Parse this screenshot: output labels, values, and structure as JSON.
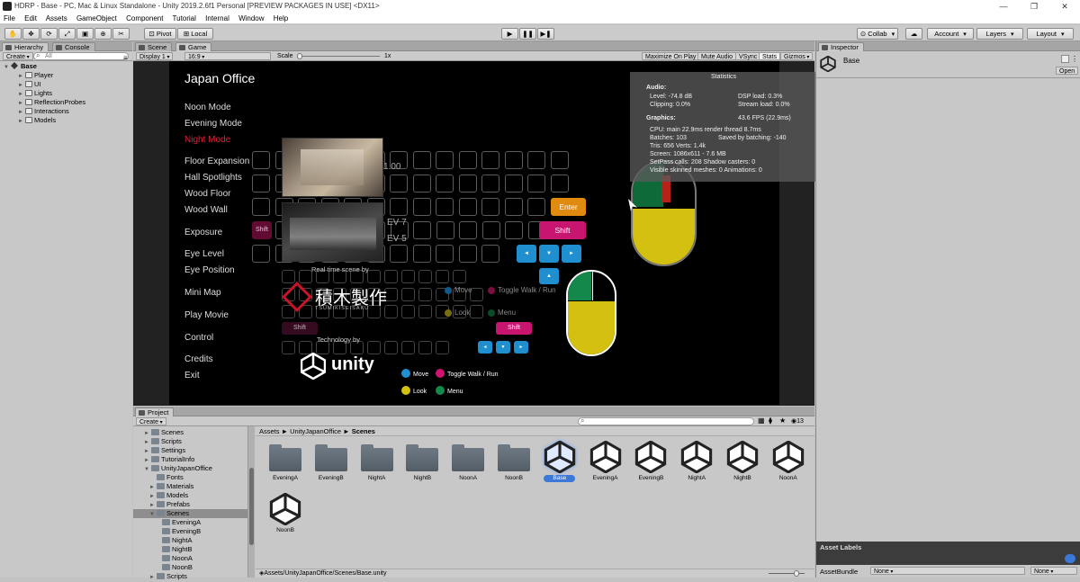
{
  "window": {
    "title": "HDRP - Base - PC, Mac & Linux Standalone - Unity 2019.2.6f1 Personal [PREVIEW PACKAGES IN USE] <DX11>",
    "controls": [
      "—",
      "❐",
      "✕"
    ]
  },
  "menu": [
    "File",
    "Edit",
    "Assets",
    "GameObject",
    "Component",
    "Tutorial",
    "Internal",
    "Window",
    "Help"
  ],
  "toolbar": {
    "pivot_label": "Pivot",
    "local_label": "Local",
    "collab_label": "Collab",
    "account_label": "Account",
    "layers_label": "Layers",
    "layout_label": "Layout",
    "transform_tools": [
      "hand-tool-icon",
      "move-tool-icon",
      "rotate-tool-icon",
      "scale-tool-icon",
      "rect-tool-icon",
      "transform-tool-icon",
      "custom-tool-icon"
    ],
    "play_glyph": "▶",
    "pause_glyph": "❚❚",
    "step_glyph": "▶❚"
  },
  "hierarchy": {
    "tab": "Hierarchy",
    "create": "Create",
    "search_placeholder": "All",
    "root": "Base",
    "items": [
      "Player",
      "UI",
      "Lights",
      "ReflectionProbes",
      "Interactions",
      "Models"
    ]
  },
  "console_tab": "Console",
  "game": {
    "scene_tab": "Scene",
    "game_tab": "Game",
    "display": "Display 1",
    "aspect": "16:9",
    "scale_label": "Scale",
    "scale_value": "1x",
    "maximize": "Maximize On Play",
    "mute": "Mute Audio",
    "vsync": "VSync",
    "stats": "Stats",
    "gizmos": "Gizmos"
  },
  "game_ui": {
    "title": "Japan Office",
    "menu_items": [
      {
        "label": "Noon Mode",
        "active": false
      },
      {
        "label": "Evening Mode",
        "active": false
      },
      {
        "label": "Night Mode",
        "active": true
      },
      {
        "label": "Floor Expansion",
        "active": false
      },
      {
        "label": "Hall Spotlights",
        "active": false
      },
      {
        "label": "Wood Floor",
        "active": false
      },
      {
        "label": "Wood Wall",
        "active": false
      },
      {
        "label": "Exposure",
        "active": false
      },
      {
        "label": "Eye Level",
        "active": false
      },
      {
        "label": "Eye Position",
        "active": false
      },
      {
        "label": "Mini Map",
        "active": false
      },
      {
        "label": "Play Movie",
        "active": false
      },
      {
        "label": "Control",
        "active": false
      },
      {
        "label": "Credits",
        "active": false
      },
      {
        "label": "Exit",
        "active": false
      }
    ],
    "value_100": "1.00",
    "ev_7": "EV 7",
    "ev_5": "EV 5",
    "enter_key": "Enter",
    "shift_key": "Shift",
    "shift_key_small": "Shift",
    "shift_key_left": "Shift",
    "realtime_by": "Real time scene by",
    "brand_kanji": "積木製作",
    "brand_roman": "TSUMIKISEISAKU",
    "technology_by": "Technology by",
    "unity_logo": "unity",
    "legend": [
      {
        "label": "Move",
        "color": "#1f8fd0"
      },
      {
        "label": "Toggle Walk / Run",
        "color": "#d0136f"
      },
      {
        "label": "Look",
        "color": "#d4c010"
      },
      {
        "label": "Menu",
        "color": "#14884a"
      }
    ],
    "ghost_move": "Move",
    "ghost_toggle": "Toggle Walk / Run",
    "ghost_look": "Look",
    "ghost_menu": "Menu",
    "arrow_up": "▲",
    "arrow_down": "▼",
    "arrow_left": "◄",
    "arrow_right": "►"
  },
  "stats": {
    "header": "Statistics",
    "audio_heading": "Audio:",
    "level": "Level: -74.8 dB",
    "clipping": "Clipping: 0.0%",
    "dsp": "DSP load: 0.3%",
    "stream": "Stream load: 0.0%",
    "graphics_heading": "Graphics:",
    "fps": "43.6 FPS (22.9ms)",
    "cpu": "CPU: main 22.9ms  render thread 8.7ms",
    "batches": "Batches: 103",
    "saved_batching": "Saved by batching: -140",
    "tris": "Tris: 656  Verts: 1.4k",
    "screen": "Screen: 1086x611 - 7.6 MB",
    "setpass": "SetPass calls: 208   Shadow casters: 0",
    "skinned": "Visible skinned meshes: 0  Animations: 0"
  },
  "inspector": {
    "tab": "Inspector",
    "object": "Base",
    "open_button": "Open",
    "asset_labels": "Asset Labels",
    "assetbundle_label": "AssetBundle",
    "assetbundle_value": "None",
    "assetbundle_variant": "None"
  },
  "project": {
    "tab": "Project",
    "create": "Create",
    "count": "13",
    "breadcrumb": [
      "Assets",
      "UnityJapanOffice",
      "Scenes"
    ],
    "path": "Assets/UnityJapanOffice/Scenes/Base.unity",
    "tree": [
      {
        "label": "Scenes",
        "depth": 1,
        "arrow": "►"
      },
      {
        "label": "Scripts",
        "depth": 1,
        "arrow": "►"
      },
      {
        "label": "Settings",
        "depth": 1,
        "arrow": "►"
      },
      {
        "label": "TutorialInfo",
        "depth": 1,
        "arrow": "►"
      },
      {
        "label": "UnityJapanOffice",
        "depth": 1,
        "arrow": "▼"
      },
      {
        "label": "Fonts",
        "depth": 2,
        "arrow": ""
      },
      {
        "label": "Materials",
        "depth": 2,
        "arrow": "►"
      },
      {
        "label": "Models",
        "depth": 2,
        "arrow": "►"
      },
      {
        "label": "Prefabs",
        "depth": 2,
        "arrow": "►"
      },
      {
        "label": "Scenes",
        "depth": 2,
        "arrow": "▼",
        "selected": true
      },
      {
        "label": "EveningA",
        "depth": 3,
        "arrow": ""
      },
      {
        "label": "EveningB",
        "depth": 3,
        "arrow": ""
      },
      {
        "label": "NightA",
        "depth": 3,
        "arrow": ""
      },
      {
        "label": "NightB",
        "depth": 3,
        "arrow": ""
      },
      {
        "label": "NoonA",
        "depth": 3,
        "arrow": ""
      },
      {
        "label": "NoonB",
        "depth": 3,
        "arrow": ""
      },
      {
        "label": "Scripts",
        "depth": 2,
        "arrow": "►"
      }
    ],
    "assets": [
      {
        "label": "EveningA",
        "kind": "folder"
      },
      {
        "label": "EveningB",
        "kind": "folder"
      },
      {
        "label": "NightA",
        "kind": "folder"
      },
      {
        "label": "NightB",
        "kind": "folder"
      },
      {
        "label": "NoonA",
        "kind": "folder"
      },
      {
        "label": "NoonB",
        "kind": "folder"
      },
      {
        "label": "Base",
        "kind": "scene",
        "selected": true
      },
      {
        "label": "EveningA",
        "kind": "scene"
      },
      {
        "label": "EveningB",
        "kind": "scene"
      },
      {
        "label": "NightA",
        "kind": "scene"
      },
      {
        "label": "NightB",
        "kind": "scene"
      },
      {
        "label": "NoonA",
        "kind": "scene"
      },
      {
        "label": "NoonB",
        "kind": "scene"
      }
    ]
  }
}
